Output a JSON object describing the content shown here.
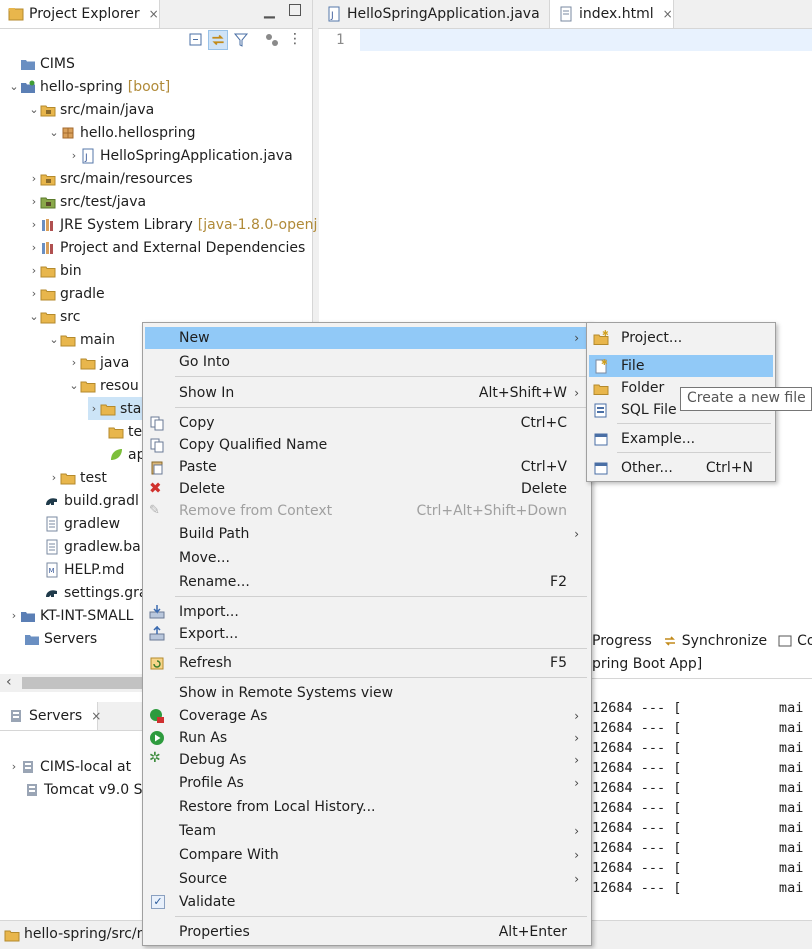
{
  "project_explorer": {
    "tab_title": "Project Explorer",
    "tab_close": "×",
    "tree": [
      {
        "label": "CIMS",
        "deco": "",
        "icon": "folder-icon"
      },
      {
        "label": "hello-spring",
        "deco": "[boot]",
        "icon": "project-icon"
      },
      {
        "label": "src/main/java",
        "deco": "",
        "icon": "source-folder-icon"
      },
      {
        "label": "hello.hellospring",
        "deco": "",
        "icon": "package-icon"
      },
      {
        "label": "HelloSpringApplication.java",
        "deco": "",
        "icon": "java-file-icon"
      },
      {
        "label": "src/main/resources",
        "deco": "",
        "icon": "source-folder-icon"
      },
      {
        "label": "src/test/java",
        "deco": "",
        "icon": "source-folder-icon"
      },
      {
        "label": "JRE System Library",
        "deco": "[java-1.8.0-openj",
        "icon": "library-icon"
      },
      {
        "label": "Project and External Dependencies",
        "deco": "",
        "icon": "library-icon"
      },
      {
        "label": "bin",
        "deco": "",
        "icon": "folder-icon"
      },
      {
        "label": "gradle",
        "deco": "",
        "icon": "folder-icon"
      },
      {
        "label": "src",
        "deco": "",
        "icon": "folder-icon"
      },
      {
        "label": "main",
        "deco": "",
        "icon": "folder-icon"
      },
      {
        "label": "java",
        "deco": "",
        "icon": "folder-icon"
      },
      {
        "label": "resou",
        "deco": "",
        "icon": "folder-icon"
      },
      {
        "label": "sta",
        "deco": "",
        "icon": "folder-icon"
      },
      {
        "label": "te",
        "deco": "",
        "icon": "folder-icon"
      },
      {
        "label": "ap",
        "deco": "",
        "icon": "spring-leaf-icon"
      },
      {
        "label": "test",
        "deco": "",
        "icon": "folder-icon"
      },
      {
        "label": "build.gradl",
        "deco": "",
        "icon": "gradle-icon"
      },
      {
        "label": "gradlew",
        "deco": "",
        "icon": "file-icon"
      },
      {
        "label": "gradlew.ba",
        "deco": "",
        "icon": "file-icon"
      },
      {
        "label": "HELP.md",
        "deco": "",
        "icon": "markdown-file-icon"
      },
      {
        "label": "settings.gra",
        "deco": "",
        "icon": "gradle-icon"
      },
      {
        "label": "KT-INT-SMALL",
        "deco": "",
        "icon": "project-icon"
      },
      {
        "label": "Servers",
        "deco": "",
        "icon": "folder-icon"
      }
    ]
  },
  "servers_view": {
    "tab_title": "Servers",
    "tab_close": "×",
    "items": [
      {
        "label": "CIMS-local at"
      },
      {
        "label": "Tomcat v9.0 S"
      }
    ]
  },
  "editor": {
    "tabs": [
      {
        "label": "HelloSpringApplication.java",
        "close": ""
      },
      {
        "label": "index.html",
        "close": "×"
      }
    ],
    "line_number": "1"
  },
  "bottom_views": {
    "progress_tab": "Progress",
    "synchronize_tab": "Synchronize",
    "third_tab": "Co",
    "console_title": "pring Boot App]",
    "console_lines": [
      "12684 --- [            mai",
      "12684 --- [            mai",
      "12684 --- [            mai",
      "12684 --- [            mai",
      "12684 --- [            mai",
      "12684 --- [            mai",
      "12684 --- [            mai",
      "12684 --- [            mai",
      "12684 --- [            mai",
      "12684 --- [            mai"
    ]
  },
  "status_bar": {
    "path": "hello-spring/src/r"
  },
  "context_menu": {
    "items": [
      {
        "label": "New",
        "accel": "",
        "submenu": "›",
        "icon": ""
      },
      {
        "label": "Go Into",
        "accel": "",
        "submenu": "",
        "icon": ""
      },
      {
        "label": "Show In",
        "accel": "Alt+Shift+W",
        "submenu": "›",
        "icon": ""
      },
      {
        "label": "Copy",
        "accel": "Ctrl+C",
        "submenu": "",
        "icon": "copy-icon"
      },
      {
        "label": "Copy Qualified Name",
        "accel": "",
        "submenu": "",
        "icon": "copy-icon"
      },
      {
        "label": "Paste",
        "accel": "Ctrl+V",
        "submenu": "",
        "icon": "paste-icon"
      },
      {
        "label": "Delete",
        "accel": "Delete",
        "submenu": "",
        "icon": "delete-icon"
      },
      {
        "label": "Remove from Context",
        "accel": "Ctrl+Alt+Shift+Down",
        "submenu": "",
        "icon": "remove-context-icon"
      },
      {
        "label": "Build Path",
        "accel": "",
        "submenu": "›",
        "icon": ""
      },
      {
        "label": "Move...",
        "accel": "",
        "submenu": "",
        "icon": ""
      },
      {
        "label": "Rename...",
        "accel": "F2",
        "submenu": "",
        "icon": ""
      },
      {
        "label": "Import...",
        "accel": "",
        "submenu": "",
        "icon": "import-icon"
      },
      {
        "label": "Export...",
        "accel": "",
        "submenu": "",
        "icon": "export-icon"
      },
      {
        "label": "Refresh",
        "accel": "F5",
        "submenu": "",
        "icon": "refresh-icon"
      },
      {
        "label": "Show in Remote Systems view",
        "accel": "",
        "submenu": "",
        "icon": ""
      },
      {
        "label": "Coverage As",
        "accel": "",
        "submenu": "›",
        "icon": "coverage-icon"
      },
      {
        "label": "Run As",
        "accel": "",
        "submenu": "›",
        "icon": "run-icon"
      },
      {
        "label": "Debug As",
        "accel": "",
        "submenu": "›",
        "icon": "debug-icon"
      },
      {
        "label": "Profile As",
        "accel": "",
        "submenu": "›",
        "icon": ""
      },
      {
        "label": "Restore from Local History...",
        "accel": "",
        "submenu": "",
        "icon": ""
      },
      {
        "label": "Team",
        "accel": "",
        "submenu": "›",
        "icon": ""
      },
      {
        "label": "Compare With",
        "accel": "",
        "submenu": "›",
        "icon": ""
      },
      {
        "label": "Source",
        "accel": "",
        "submenu": "›",
        "icon": ""
      },
      {
        "label": "Validate",
        "accel": "",
        "submenu": "",
        "icon": "check-icon"
      },
      {
        "label": "Properties",
        "accel": "Alt+Enter",
        "submenu": "",
        "icon": ""
      }
    ]
  },
  "new_submenu": {
    "items": [
      {
        "label": "Project...",
        "accel": ""
      },
      {
        "label": "File",
        "accel": ""
      },
      {
        "label": "Folder",
        "accel": ""
      },
      {
        "label": "SQL File",
        "accel": ""
      },
      {
        "label": "Example...",
        "accel": ""
      },
      {
        "label": "Other...",
        "accel": "Ctrl+N"
      }
    ]
  },
  "tooltip": {
    "text": "Create a new file r"
  },
  "colors": {
    "menu_highlight": "#91c9f7",
    "selection": "#cce4f7",
    "folder": "#e8b64c",
    "deco": "#b08a38"
  }
}
